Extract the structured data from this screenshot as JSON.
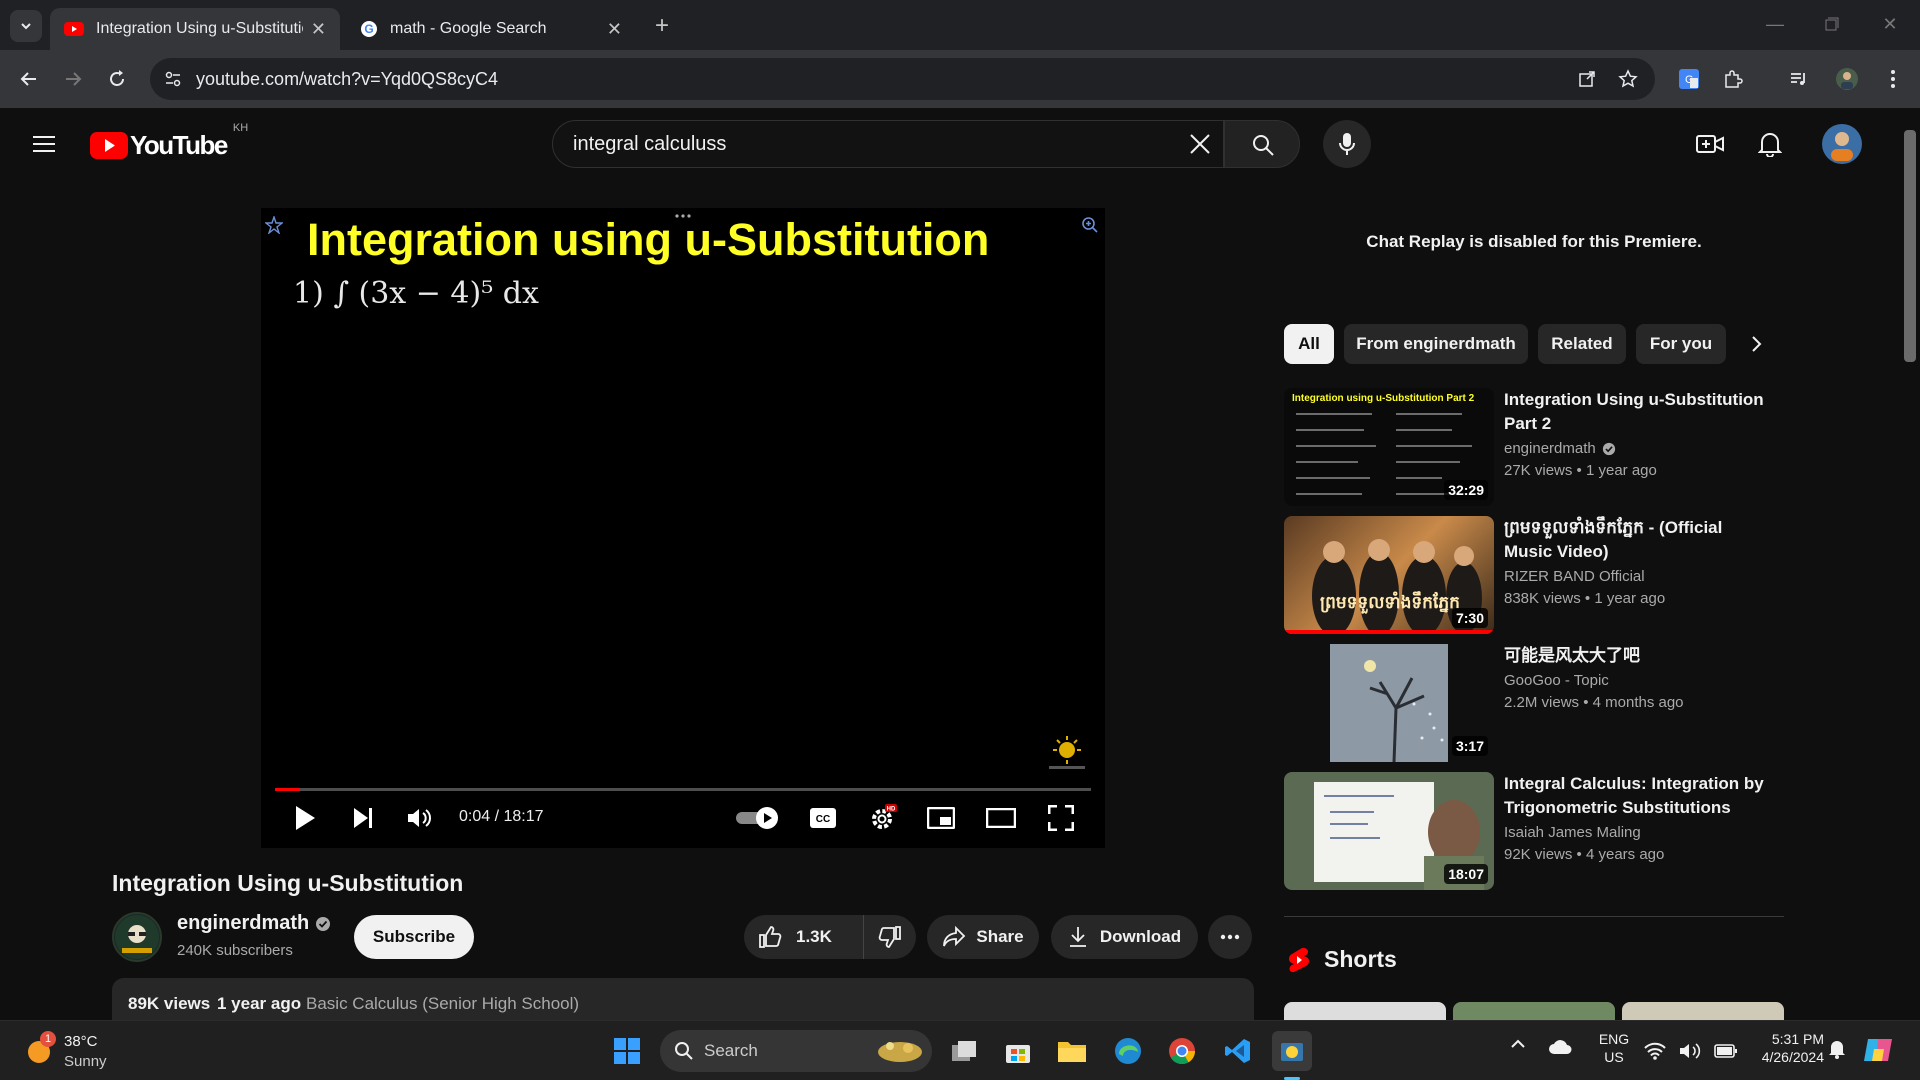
{
  "browser": {
    "tabs": [
      {
        "title": "Integration Using u-Substitution",
        "active": true
      },
      {
        "title": "math - Google Search",
        "active": false
      }
    ],
    "url": "youtube.com/watch?v=Yqd0QS8cyC4"
  },
  "youtube": {
    "logo_text": "YouTube",
    "region": "KH",
    "search_query": "integral calculuss",
    "player": {
      "slide_title": "Integration using u-Substitution",
      "slide_math": "1) ∫ (3x − 4)⁵ dx",
      "time": "0:04 / 18:17",
      "progress": 0.004
    },
    "video": {
      "title": "Integration Using u-Substitution",
      "channel": "enginerdmath",
      "subscribers": "240K subscribers",
      "subscribe_label": "Subscribe",
      "likes": "1.3K",
      "share_label": "Share",
      "download_label": "Download",
      "views": "89K views",
      "age": "1 year ago",
      "playlist": "Basic Calculus (Senior High School)"
    },
    "chat_replay": "Chat Replay is disabled for this Premiere.",
    "chips": [
      "All",
      "From enginerdmath",
      "Related",
      "For you"
    ],
    "recommendations": [
      {
        "title": "Integration Using u-Substitution Part 2",
        "channel": "enginerdmath",
        "views": "27K views",
        "age": "1 year ago",
        "duration": "32:29",
        "thumb_label": "Integration using u-Substitution Part 2"
      },
      {
        "title": "ព្រមទទួលទាំងទឹកភ្នែក - (Official Music Video)",
        "channel": "RIZER BAND Official",
        "views": "838K views",
        "age": "1 year ago",
        "duration": "7:30",
        "thumb_label": "ព្រមទទួលទាំងទឹកភ្នែក"
      },
      {
        "title": "可能是风太大了吧",
        "channel": "GooGoo - Topic",
        "views": "2.2M views",
        "age": "4 months ago",
        "duration": "3:17",
        "thumb_label": ""
      },
      {
        "title": "Integral Calculus: Integration by Trigonometric Substitutions",
        "channel": "Isaiah James Maling",
        "views": "92K views",
        "age": "4 years ago",
        "duration": "18:07",
        "thumb_label": ""
      }
    ],
    "shorts_label": "Shorts"
  },
  "taskbar": {
    "weather_temp": "38°C",
    "weather_desc": "Sunny",
    "weather_badge": "1",
    "search_label": "Search",
    "lang_top": "ENG",
    "lang_bottom": "US",
    "time": "5:31 PM",
    "date": "4/26/2024"
  },
  "colors": {
    "youtube_red": "#ff0000",
    "slide_yellow": "#ffff26",
    "background": "#0f0f0f"
  }
}
